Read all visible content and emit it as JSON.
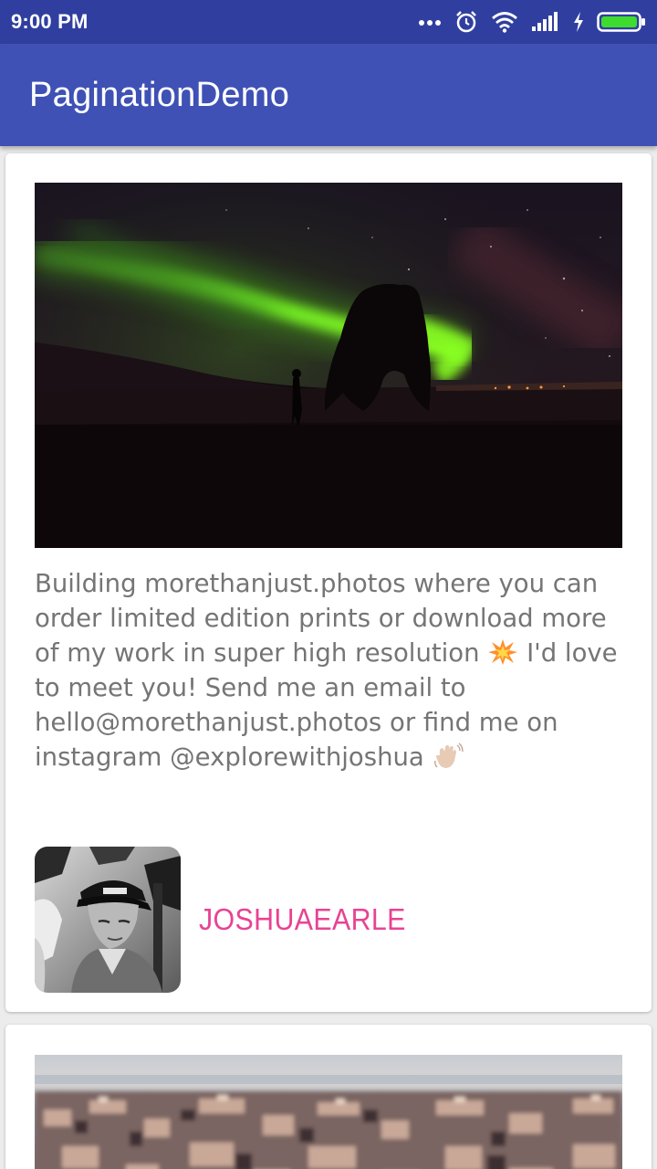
{
  "status_bar": {
    "time": "9:00 PM",
    "icons": [
      "more-dots-icon",
      "alarm-icon",
      "wifi-icon",
      "signal-icon",
      "charging-icon",
      "battery-icon"
    ]
  },
  "app_bar": {
    "title": "PaginationDemo"
  },
  "posts": [
    {
      "image": "aurora-landscape-photo",
      "description_line_1": "Building morethanjust.photos where you can order limited edition prints or download more of my work in super high resolution",
      "description_line_2": "I'd love to meet you! Send me an email to hello@morethanjust.photos or find me on instagram @explorewithjoshua",
      "emojis": [
        "collision-emoji",
        "waving-hand-emoji"
      ],
      "author": {
        "username": "JOSHUAEARLE",
        "avatar": "author-avatar-photo"
      }
    },
    {
      "image": "city-aerial-photo"
    }
  ],
  "colors": {
    "status_bar": "#303f9f",
    "app_bar": "#3f51b5",
    "author_name": "#e84393",
    "description_text": "#757575",
    "background": "#ececec"
  }
}
